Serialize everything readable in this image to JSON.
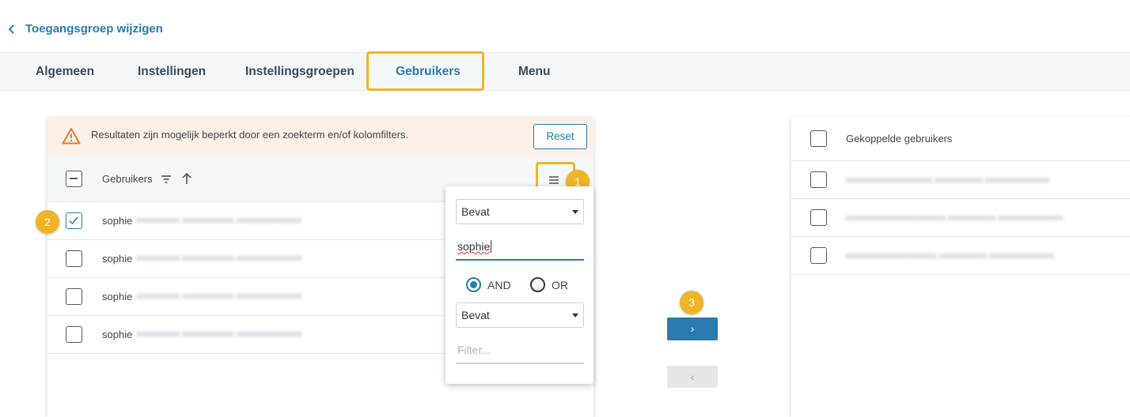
{
  "header": {
    "back_label": "Toegangsgroep wijzigen"
  },
  "tabs": [
    {
      "label": "Algemeen"
    },
    {
      "label": "Instellingen"
    },
    {
      "label": "Instellingsgroepen"
    },
    {
      "label": "Gebruikers",
      "active": true
    },
    {
      "label": "Menu"
    }
  ],
  "left_panel": {
    "warning_text": "Resultaten zijn mogelijk beperkt door een zoekterm en/of kolomfilters.",
    "reset_label": "Reset",
    "column_label": "Gebruikers",
    "rows": [
      {
        "name": "sophie",
        "checked": true
      },
      {
        "name": "sophie",
        "checked": false
      },
      {
        "name": "sophie",
        "checked": false
      },
      {
        "name": "sophie",
        "checked": false
      }
    ]
  },
  "filter_popup": {
    "condition1": "Bevat",
    "value1": "sophie",
    "and_label": "AND",
    "or_label": "OR",
    "selected_operator": "AND",
    "condition2": "Bevat",
    "value2_placeholder": "Filter..."
  },
  "transfer": {
    "move_right": "›",
    "move_left": "‹"
  },
  "right_panel": {
    "column_label": "Gekoppelde gebruikers"
  },
  "annotations": [
    {
      "label": "1"
    },
    {
      "label": "2"
    },
    {
      "label": "3"
    }
  ],
  "colors": {
    "accent": "#2a7ab0",
    "highlight": "#f0b429",
    "warning_bg": "#fcf1e8"
  }
}
